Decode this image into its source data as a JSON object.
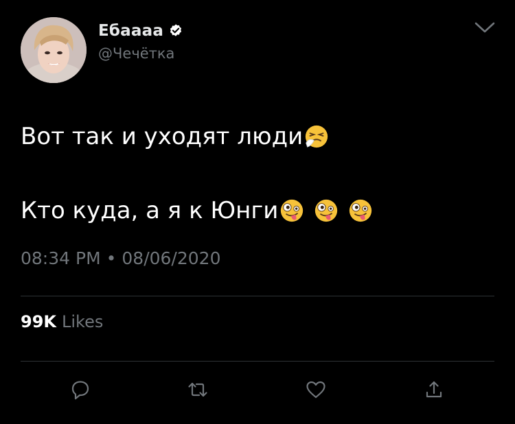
{
  "author": {
    "display_name": "Ебаааа",
    "handle": "@Чечётка",
    "verified": true
  },
  "tweet": {
    "line1": "Вот так и уходят люди",
    "line1_emoji": [
      "sneezing-face-emoji"
    ],
    "line2": "Кто куда, а я к Юнги",
    "line2_emoji": [
      "zany-face-emoji",
      "zany-face-emoji",
      "zany-face-emoji"
    ]
  },
  "meta": {
    "time": "08:34 PM",
    "separator": "•",
    "date": "08/06/2020"
  },
  "stats": {
    "likes_count": "99K",
    "likes_label": "Likes"
  },
  "icons": {
    "menu": "chevron-down-icon",
    "reply": "reply-icon",
    "retweet": "retweet-icon",
    "like": "heart-icon",
    "share": "share-icon"
  },
  "colors": {
    "background": "#000000",
    "text": "#ffffff",
    "secondary": "#71767b",
    "divider": "#2f3336"
  }
}
